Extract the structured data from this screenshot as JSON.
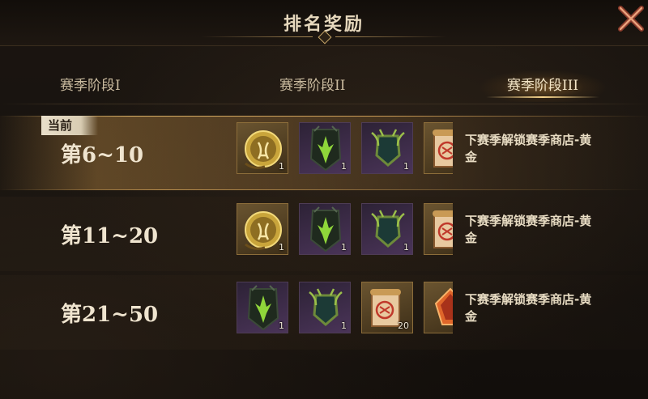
{
  "header": {
    "title": "排名奖励"
  },
  "tabs": [
    {
      "label": "赛季阶段I"
    },
    {
      "label": "赛季阶段II"
    },
    {
      "label": "赛季阶段III"
    }
  ],
  "active_tab": 2,
  "current_badge": "当前",
  "rows": [
    {
      "rank": "第6~10",
      "items": [
        {
          "icon": "gold-emblem-icon",
          "qty": "1"
        },
        {
          "icon": "green-thorn-shield-icon",
          "qty": "1"
        },
        {
          "icon": "vine-crest-icon",
          "qty": "1"
        },
        {
          "icon": "scroll-icon",
          "qty": ""
        }
      ],
      "reward_text": "下赛季解锁赛季商店-黄金"
    },
    {
      "rank": "第11~20",
      "items": [
        {
          "icon": "gold-emblem-icon",
          "qty": "1"
        },
        {
          "icon": "green-thorn-shield-icon",
          "qty": "1"
        },
        {
          "icon": "vine-crest-icon",
          "qty": "1"
        },
        {
          "icon": "scroll-icon",
          "qty": ""
        }
      ],
      "reward_text": "下赛季解锁赛季商店-黄金"
    },
    {
      "rank": "第21~50",
      "items": [
        {
          "icon": "green-thorn-shield-icon",
          "qty": "1"
        },
        {
          "icon": "vine-crest-icon",
          "qty": "1"
        },
        {
          "icon": "scroll-icon",
          "qty": "20"
        },
        {
          "icon": "fire-crystal-icon",
          "qty": ""
        }
      ],
      "reward_text": "下赛季解锁赛季商店-黄金"
    }
  ],
  "colors": {
    "gold_accent": "#d9b066",
    "text_light": "#efe4cf",
    "background": "#17130f"
  }
}
